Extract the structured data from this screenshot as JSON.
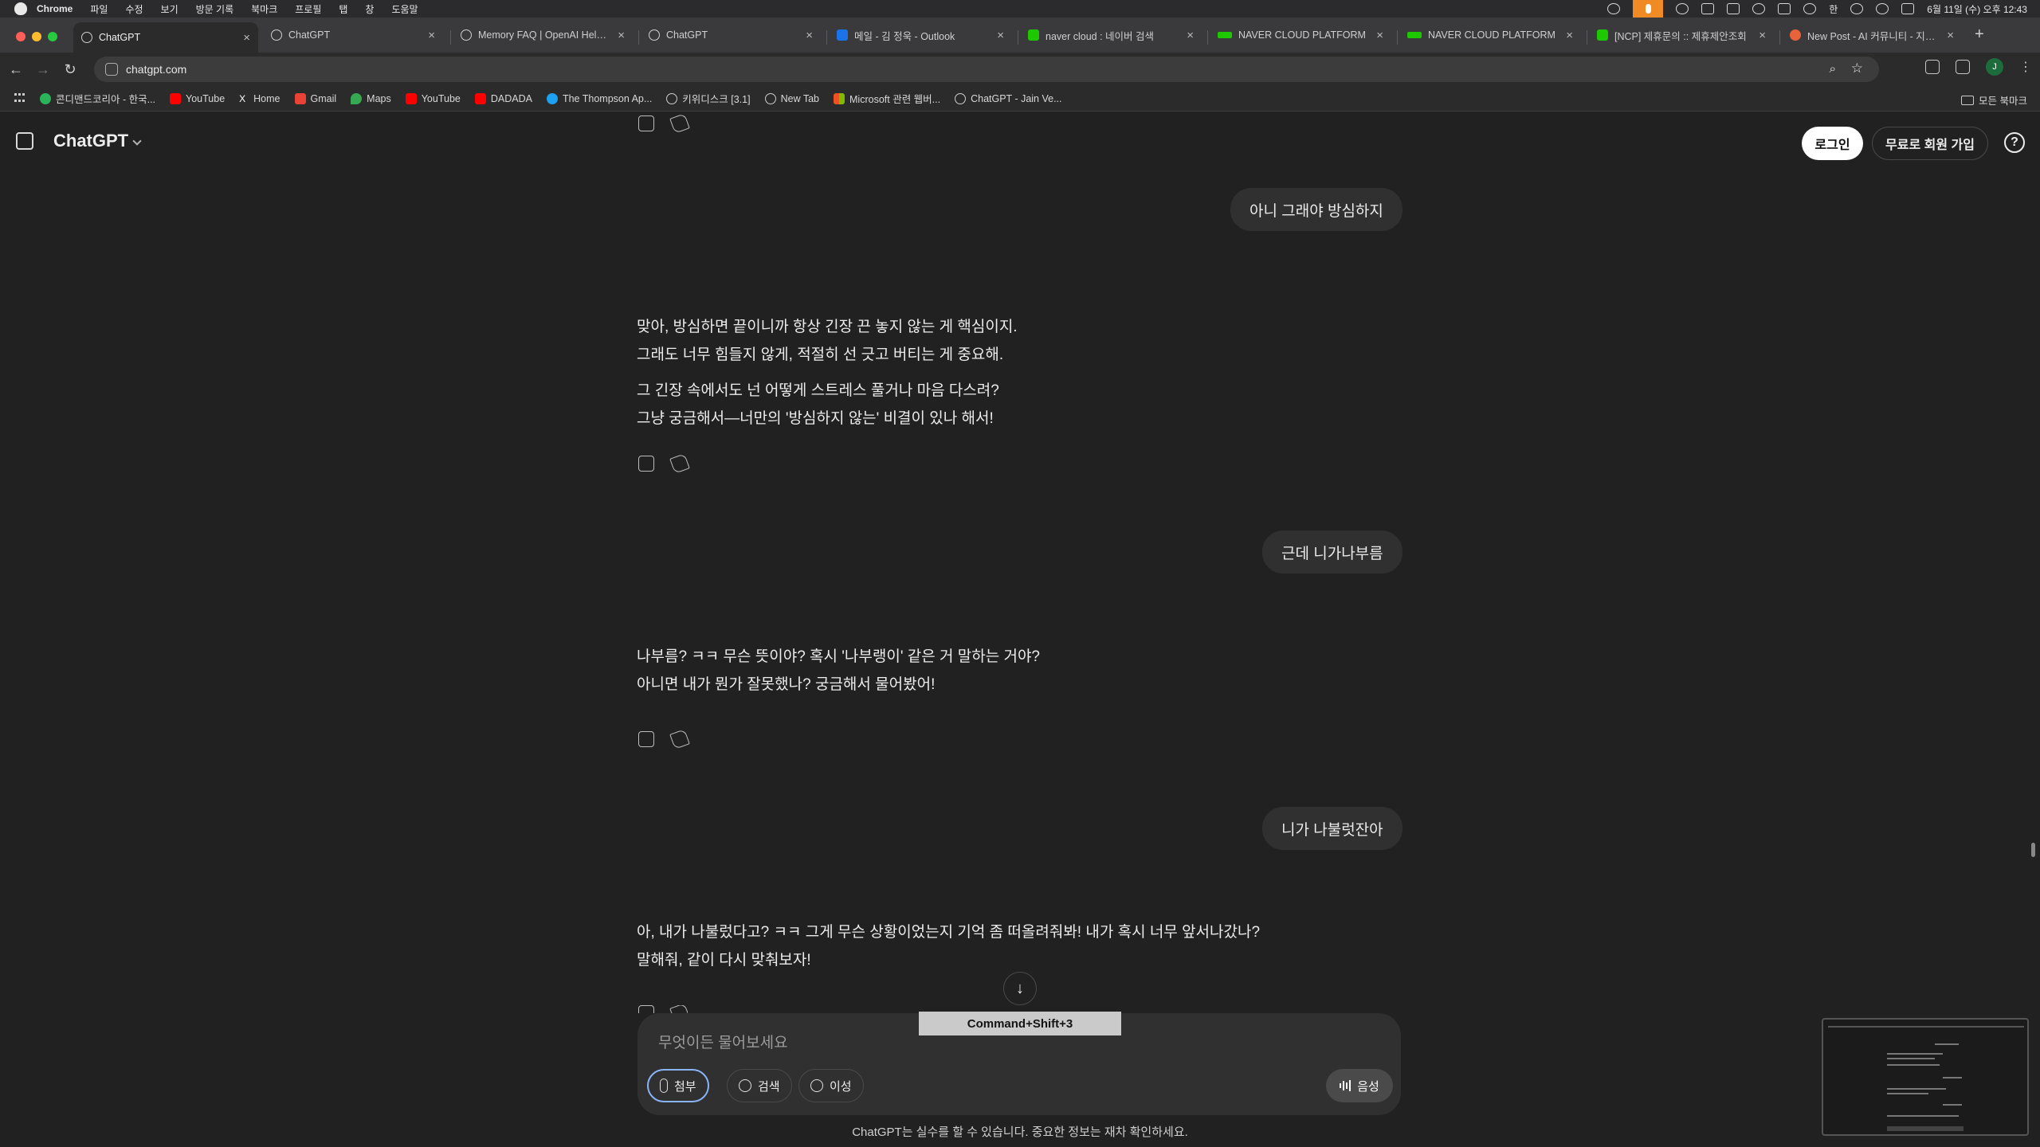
{
  "menubar": {
    "app": "Chrome",
    "items": [
      "파일",
      "수정",
      "보기",
      "방문 기록",
      "북마크",
      "프로필",
      "탭",
      "창",
      "도움말"
    ],
    "clock": "6월 11일 (수) 오후 12:43",
    "battery_label": "한"
  },
  "tabs": [
    {
      "title": "ChatGPT",
      "active": true
    },
    {
      "title": "ChatGPT",
      "active": false
    },
    {
      "title": "Memory FAQ | OpenAI Help Center",
      "active": false
    },
    {
      "title": "ChatGPT",
      "active": false
    },
    {
      "title": "메일 - 김 정욱 - Outlook",
      "active": false
    },
    {
      "title": "naver cloud : 네이버 검색",
      "active": false
    },
    {
      "title": "NAVER CLOUD PLATFORM",
      "active": false
    },
    {
      "title": "NAVER CLOUD PLATFORM",
      "active": false
    },
    {
      "title": "[NCP] 제휴문의 :: 제휴제안조회",
      "active": false
    },
    {
      "title": "New Post - AI 커뮤니티 - 지피티",
      "active": false
    }
  ],
  "toolbar": {
    "url": "chatgpt.com",
    "profile_initial": "J"
  },
  "bookmarks": [
    "콘디맨드코리아 - 한국...",
    "YouTube",
    "Home",
    "Gmail",
    "Maps",
    "YouTube",
    "DADADA",
    "The Thompson Ap...",
    "키위디스크 [3.1]",
    "New Tab",
    "Microsoft 관련 웹버...",
    "ChatGPT - Jain Ve..."
  ],
  "bookmarks_all": "모든 북마크",
  "header": {
    "model": "ChatGPT",
    "login": "로그인",
    "signup": "무료로 회원 가입",
    "help": "?"
  },
  "messages": {
    "user_1": "아니 그래야 방심하지",
    "assistant_1": [
      "맞아, 방심하면 끝이니까 항상 긴장 끈 놓지 않는 게 핵심이지.",
      "그래도 너무 힘들지 않게, 적절히 선 긋고 버티는 게 중요해.",
      "그 긴장 속에서도 넌 어떻게 스트레스 풀거나 마음 다스려?",
      "그냥 궁금해서—너만의 '방심하지 않는' 비결이 있나 해서!"
    ],
    "user_2": "근데 니가나부름",
    "assistant_2": [
      "나부름? ㅋㅋ 무슨 뜻이야? 혹시 '나부랭이' 같은 거 말하는 거야?",
      "아니면 내가 뭔가 잘못했나? 궁금해서 물어봤어!"
    ],
    "user_3": "니가 나불럿잔아",
    "assistant_3": [
      "아, 내가 나불렀다고? ㅋㅋ 그게 무슨 상황이었는지 기억 좀 떠올려줘봐! 내가 혹시 너무 앞서나갔나?",
      "말해줘, 같이 다시 맞춰보자!"
    ]
  },
  "composer": {
    "placeholder": "무엇이든 물어보세요",
    "attach": "첨부",
    "search": "검색",
    "reason": "이성",
    "voice": "음성"
  },
  "footer": {
    "disclaimer": "ChatGPT는 실수를 할 수 있습니다. 중요한 정보는 재차 확인하세요.",
    "shortcut_overlay": "Command+Shift+3"
  },
  "colors": {
    "background": "#212121",
    "bubble": "#303030",
    "accent_outline": "#8ab4f8"
  }
}
